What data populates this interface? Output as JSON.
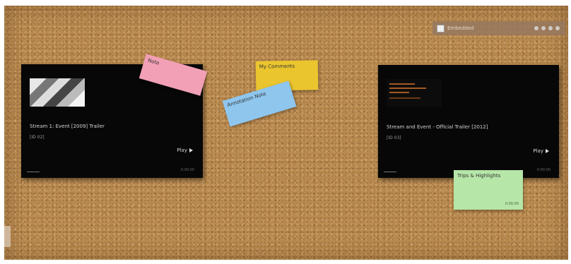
{
  "toolbar": {
    "label": "Embedded",
    "controls": [
      "zoom-out-icon",
      "zoom-in-icon",
      "settings-icon",
      "close-icon"
    ]
  },
  "cards": [
    {
      "title": "Stream 1: Event [2009] Trailer",
      "subtitle": "[ID 02]",
      "play_label": "Play",
      "corner_text": "0:00:00"
    },
    {
      "title": "Stream and Event - Official Trailer [2012]",
      "subtitle": "[ID 03]",
      "play_label": "Play",
      "corner_text": "0:00:00"
    }
  ],
  "notes": {
    "pink": "Note",
    "yellow": "My Comments",
    "blue": "Annotation Note",
    "green": "Trips & Highlights",
    "green_footer": "0:00:00"
  },
  "colors": {
    "board": "#b98a4f",
    "pink": "#f2a0b6",
    "yellow": "#ebc52e",
    "blue": "#8ec6ee",
    "green": "#b6e6a8"
  }
}
